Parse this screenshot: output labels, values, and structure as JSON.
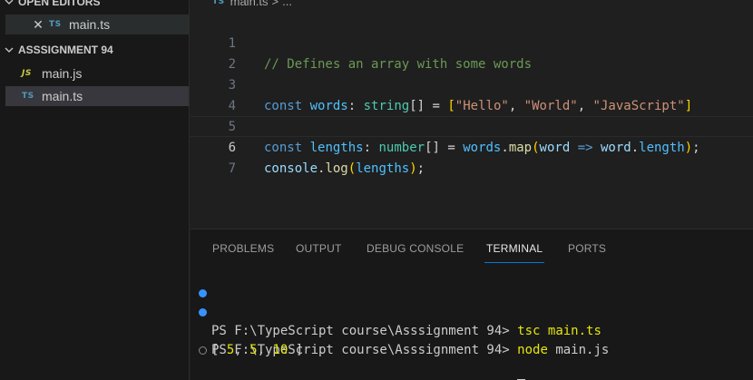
{
  "sidebar": {
    "open_editors_title": "OPEN EDITORS",
    "open_editors": [
      {
        "icon": "TS",
        "name": "main.ts"
      }
    ],
    "folder_title": "ASSSIGNMENT 94",
    "files": [
      {
        "icon": "JS",
        "name": "main.js"
      },
      {
        "icon": "TS",
        "name": "main.ts"
      }
    ]
  },
  "editor": {
    "breadcrumb": {
      "icon": "TS",
      "file": "main.ts",
      "separator": ">",
      "rest": "..."
    },
    "line_numbers": [
      "1",
      "2",
      "3",
      "4",
      "5",
      "6",
      "7"
    ],
    "code": {
      "l1_comment": "// Defines an array with some words",
      "l3": {
        "kw": "const",
        "var": "words",
        "colon": ":",
        "type": "string",
        "brackets": "[]",
        "eq": " = ",
        "open": "[",
        "s1": "\"Hello\"",
        "s2": "\"World\"",
        "s3": "\"JavaScript\"",
        "close": "]",
        "comma": ", "
      },
      "l5": {
        "kw": "const",
        "var": "lengths",
        "colon": ":",
        "type": "number",
        "brackets": "[]",
        "eq": " = ",
        "obj": "words",
        "dot": ".",
        "fn": "map",
        "open": "(",
        "param": "word",
        "arrow": " => ",
        "param2": "word",
        "prop": "length",
        "close": ")",
        "semi": ";"
      },
      "l6": {
        "obj": "console",
        "dot": ".",
        "fn": "log",
        "open": "(",
        "arg": "lengths",
        "close": ")",
        "semi": ";"
      }
    }
  },
  "panel": {
    "tabs": [
      "PROBLEMS",
      "OUTPUT",
      "DEBUG CONSOLE",
      "TERMINAL",
      "PORTS"
    ],
    "active_tab": "TERMINAL",
    "terminal": {
      "prompt": "PS F:\\TypeScript course\\Asssignment 94>",
      "cmd1": "tsc main.ts",
      "cmd2_name": "node",
      "cmd2_arg": "main.js",
      "output": {
        "open": "[ ",
        "n1": "5",
        "n2": "5",
        "n3": "10",
        "sep": ", ",
        "close": " ]"
      }
    }
  },
  "colors": {
    "accent": "#0078d4",
    "ts_icon": "#519aba",
    "js_icon": "#cbcb41",
    "comment": "#6a9955",
    "keyword": "#569cd6",
    "string": "#ce9178"
  }
}
